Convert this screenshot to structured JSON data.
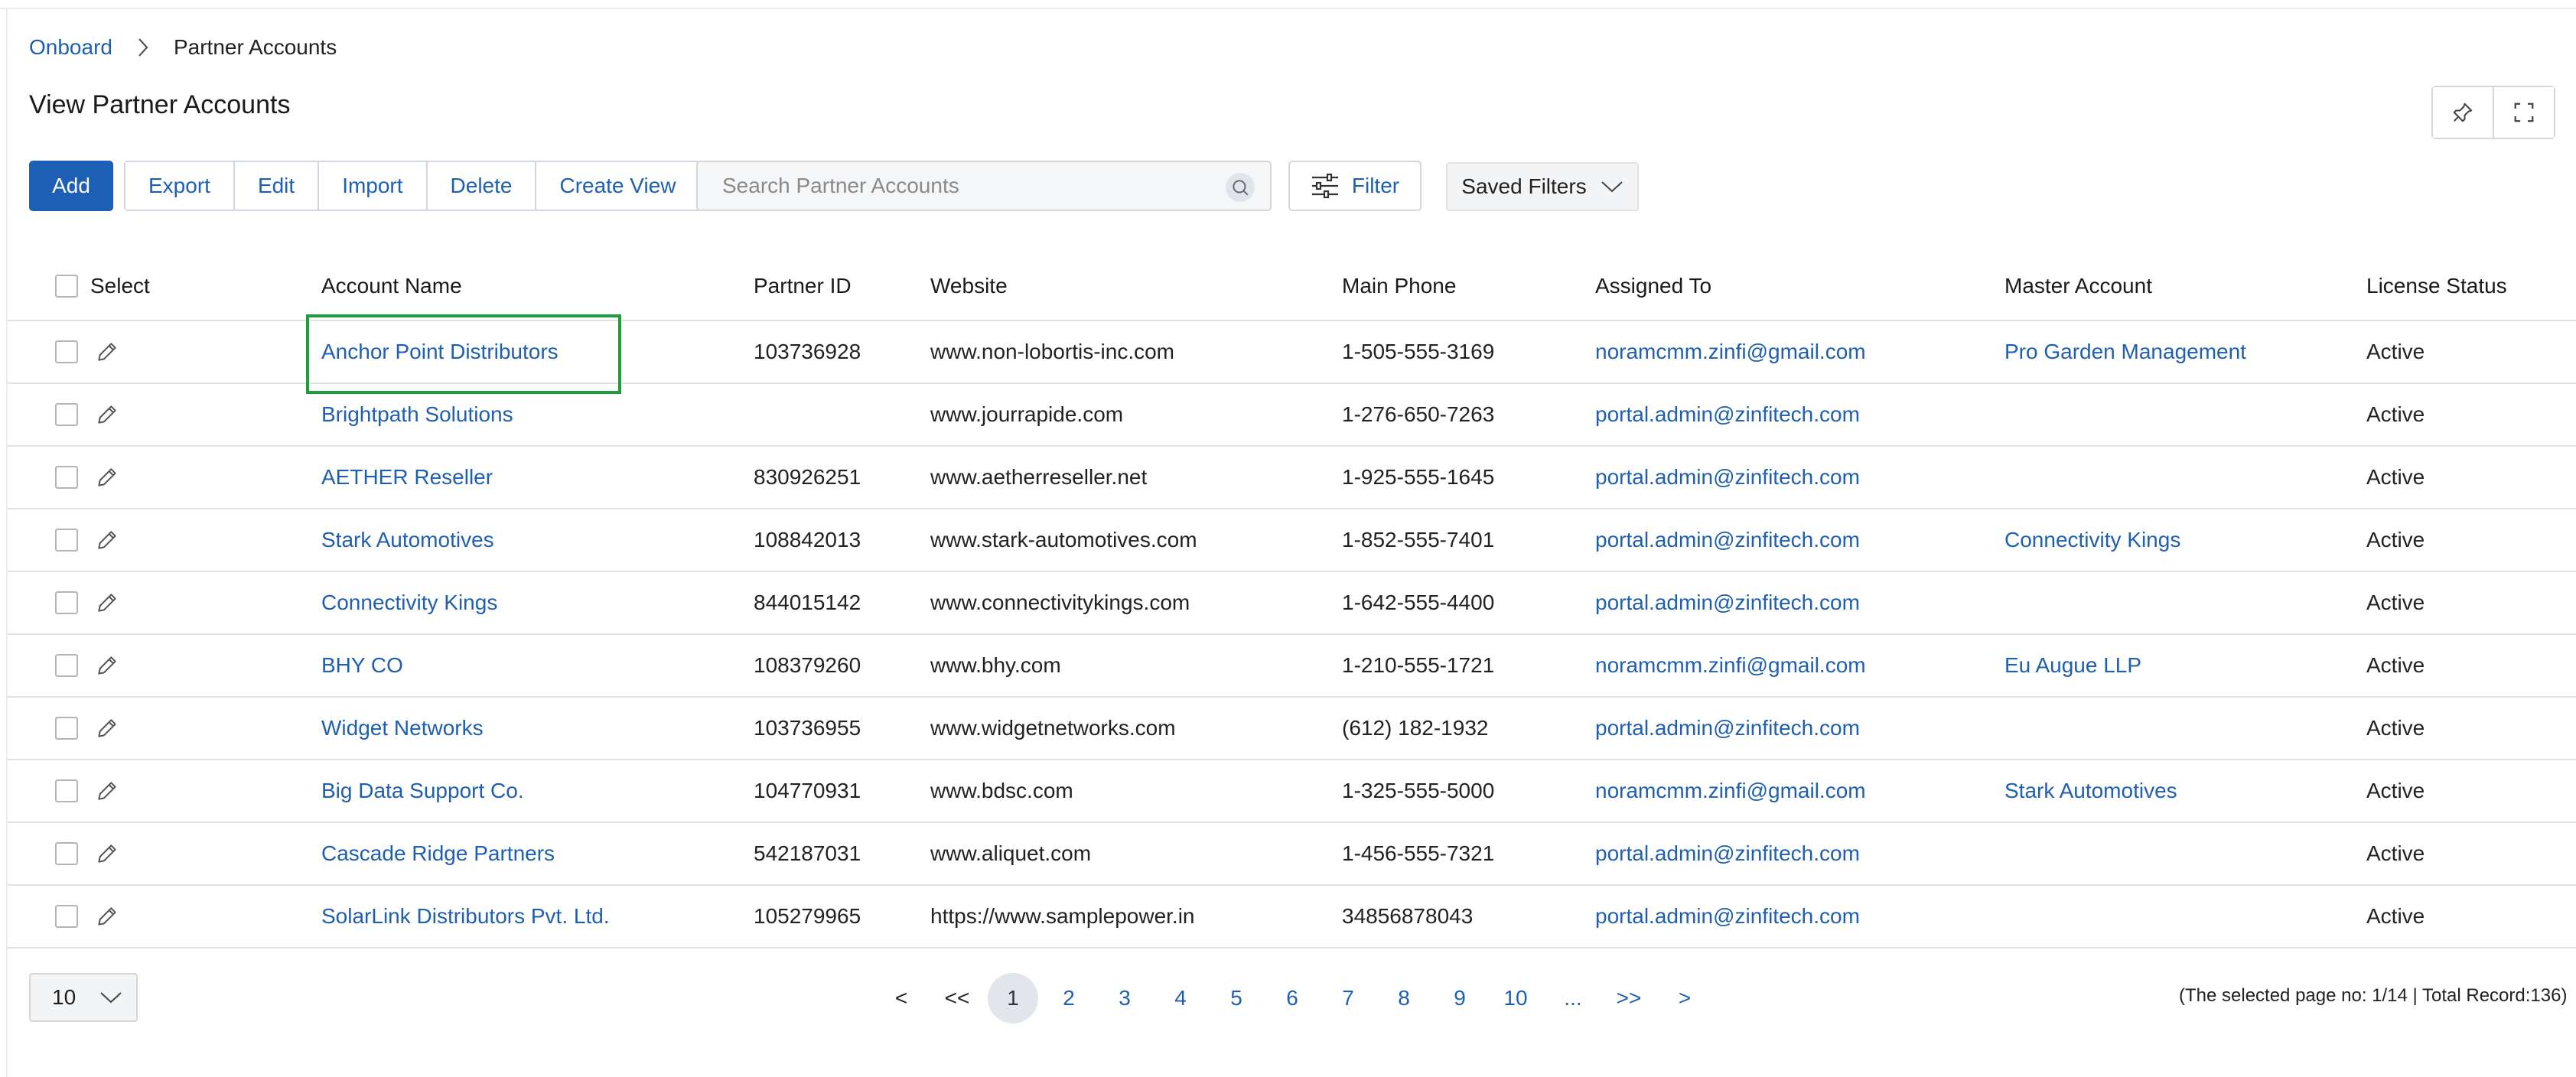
{
  "breadcrumb": {
    "root": "Onboard",
    "current": "Partner Accounts"
  },
  "page_title": "View Partner Accounts",
  "toolbar": {
    "add": "Add",
    "export": "Export",
    "edit": "Edit",
    "import": "Import",
    "delete": "Delete",
    "create_view": "Create View",
    "search_placeholder": "Search Partner Accounts",
    "filter": "Filter",
    "saved_filters": "Saved Filters"
  },
  "columns": {
    "select": "Select",
    "account_name": "Account Name",
    "partner_id": "Partner ID",
    "website": "Website",
    "main_phone": "Main Phone",
    "assigned_to": "Assigned To",
    "master_account": "Master Account",
    "license_status": "License Status"
  },
  "rows": [
    {
      "account_name": "Anchor Point Distributors",
      "partner_id": "103736928",
      "website": "www.non-lobortis-inc.com",
      "main_phone": "1-505-555-3169",
      "assigned_to": "noramcmm.zinfi@gmail.com",
      "master_account": "Pro Garden Management",
      "license_status": "Active"
    },
    {
      "account_name": "Brightpath Solutions",
      "partner_id": "",
      "website": "www.jourrapide.com",
      "main_phone": "1-276-650-7263",
      "assigned_to": "portal.admin@zinfitech.com",
      "master_account": "",
      "license_status": "Active"
    },
    {
      "account_name": "AETHER Reseller",
      "partner_id": "830926251",
      "website": "www.aetherreseller.net",
      "main_phone": "1-925-555-1645",
      "assigned_to": "portal.admin@zinfitech.com",
      "master_account": "",
      "license_status": "Active"
    },
    {
      "account_name": "Stark Automotives",
      "partner_id": "108842013",
      "website": "www.stark-automotives.com",
      "main_phone": "1-852-555-7401",
      "assigned_to": "portal.admin@zinfitech.com",
      "master_account": "Connectivity Kings",
      "license_status": "Active"
    },
    {
      "account_name": "Connectivity Kings",
      "partner_id": "844015142",
      "website": "www.connectivitykings.com",
      "main_phone": "1-642-555-4400",
      "assigned_to": "portal.admin@zinfitech.com",
      "master_account": "",
      "license_status": "Active"
    },
    {
      "account_name": "BHY CO",
      "partner_id": "108379260",
      "website": "www.bhy.com",
      "main_phone": "1-210-555-1721",
      "assigned_to": "noramcmm.zinfi@gmail.com",
      "master_account": "Eu Augue LLP",
      "license_status": "Active"
    },
    {
      "account_name": "Widget Networks",
      "partner_id": "103736955",
      "website": "www.widgetnetworks.com",
      "main_phone": "(612) 182-1932",
      "assigned_to": "portal.admin@zinfitech.com",
      "master_account": "",
      "license_status": "Active"
    },
    {
      "account_name": "Big Data Support Co.",
      "partner_id": "104770931",
      "website": "www.bdsc.com",
      "main_phone": "1-325-555-5000",
      "assigned_to": "noramcmm.zinfi@gmail.com",
      "master_account": "Stark Automotives",
      "license_status": "Active"
    },
    {
      "account_name": "Cascade Ridge Partners",
      "partner_id": "542187031",
      "website": "www.aliquet.com",
      "main_phone": "1-456-555-7321",
      "assigned_to": "portal.admin@zinfitech.com",
      "master_account": "",
      "license_status": "Active"
    },
    {
      "account_name": "SolarLink Distributors Pvt. Ltd.",
      "partner_id": "105279965",
      "website": "https://www.samplepower.in",
      "main_phone": "34856878043",
      "assigned_to": "portal.admin@zinfitech.com",
      "master_account": "",
      "license_status": "Active"
    }
  ],
  "footer": {
    "page_size": "10",
    "pagination": {
      "prev": "<",
      "first": "<<",
      "pages": [
        "1",
        "2",
        "3",
        "4",
        "5",
        "6",
        "7",
        "8",
        "9",
        "10"
      ],
      "ellipsis": "...",
      "last": ">>",
      "next": ">"
    },
    "record_info": "(The selected page no: 1/14 | Total Record:136)"
  },
  "colors": {
    "primary": "#1d5fb5",
    "link": "#1f5fb0",
    "highlight": "#1f9d3c"
  }
}
